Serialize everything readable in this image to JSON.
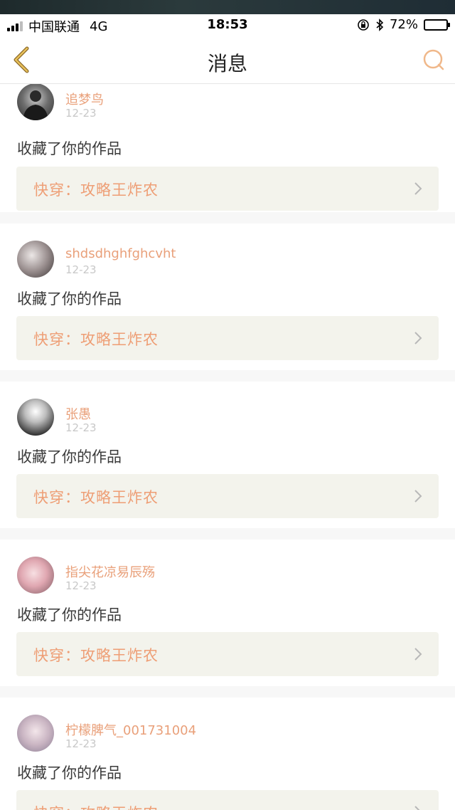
{
  "status_bar": {
    "carrier": "中国联通",
    "network": "4G",
    "time": "18:53",
    "battery": "72%",
    "battery_level": 0.72
  },
  "nav": {
    "title": "消息",
    "back_icon": "chevron-left-icon",
    "search_icon": "search-icon",
    "accent_color": "#d8a24a"
  },
  "colors": {
    "username": "#e9a07a",
    "work_title": "#ee9e75",
    "work_bg": "#f3f3ec",
    "date": "#c8c8c8"
  },
  "messages": [
    {
      "user": "追梦鸟",
      "date": "12-23",
      "action": "收藏了你的作品",
      "work": "快穿：攻略王炸农"
    },
    {
      "user": "shdsdhghfghcvht",
      "date": "12-23",
      "action": "收藏了你的作品",
      "work": "快穿：攻略王炸农"
    },
    {
      "user": "张愚",
      "date": "12-23",
      "action": "收藏了你的作品",
      "work": "快穿：攻略王炸农"
    },
    {
      "user": "指尖花凉易辰殇",
      "date": "12-23",
      "action": "收藏了你的作品",
      "work": "快穿：攻略王炸农"
    },
    {
      "user": "柠檬脾气_001731004",
      "date": "12-23",
      "action": "收藏了你的作品",
      "work": "快穿：攻略王炸农"
    }
  ]
}
